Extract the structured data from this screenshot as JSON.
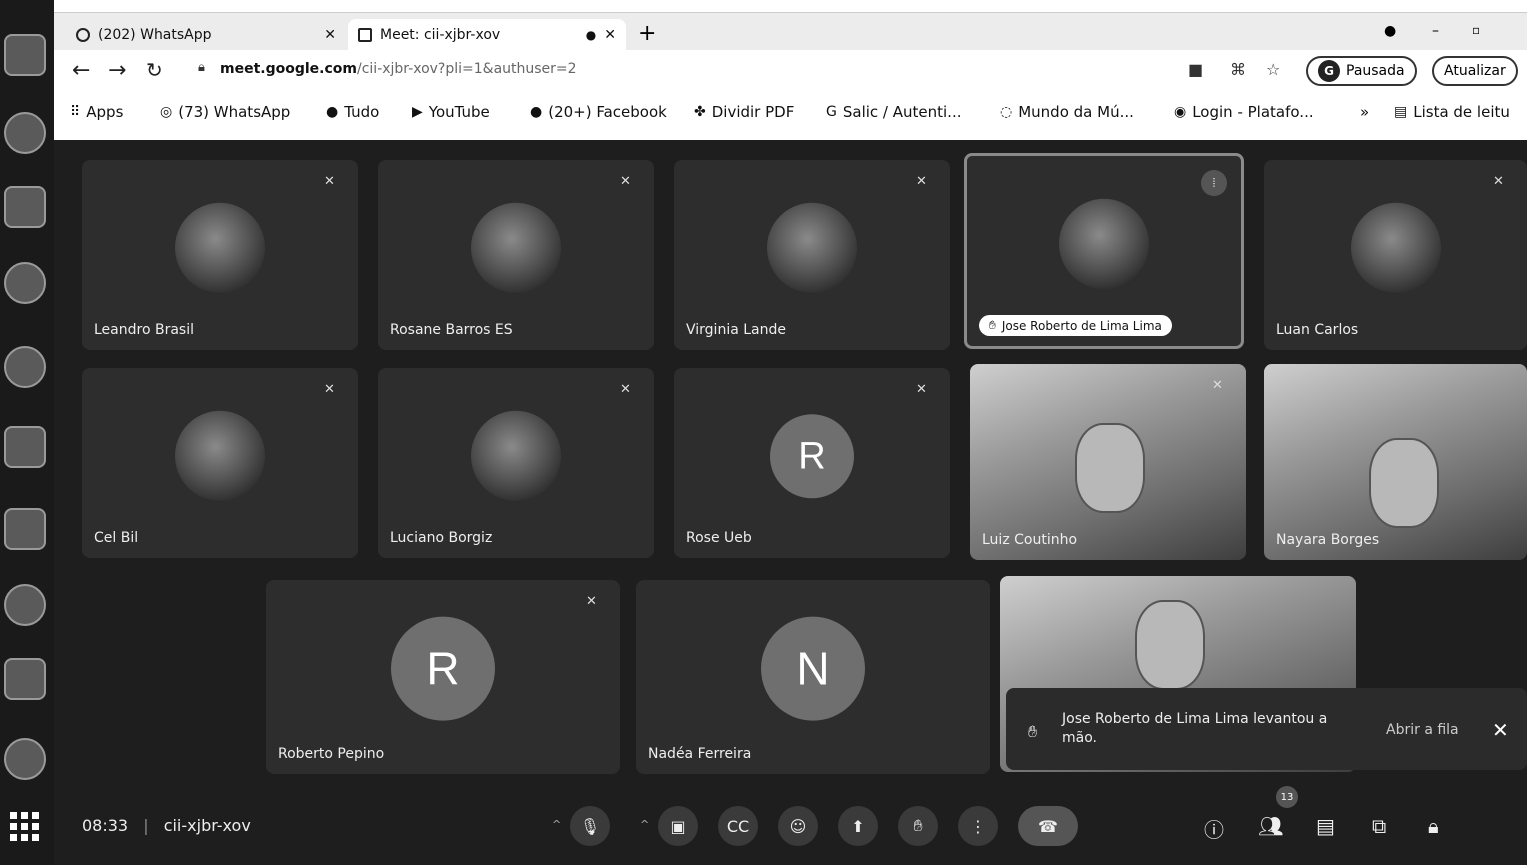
{
  "tabs": [
    {
      "title": "(202) WhatsApp",
      "icon": "whatsapp-icon"
    },
    {
      "title": "Meet: cii-xjbr-xov",
      "icon": "meet-icon"
    }
  ],
  "toolbar": {
    "url_host": "meet.google.com",
    "url_rest": "/cii-xjbr-xov?pli=1&authuser=2",
    "profile_initial": "G",
    "profile_label": "Pausada",
    "update_label": "Atualizar"
  },
  "bookmarks": [
    {
      "label": "Apps",
      "icon": "apps-grid-icon"
    },
    {
      "label": "(73) WhatsApp",
      "icon": "whatsapp-icon"
    },
    {
      "label": "Tudo",
      "icon": "facebook-icon"
    },
    {
      "label": "YouTube",
      "icon": "youtube-icon"
    },
    {
      "label": "(20+) Facebook",
      "icon": "facebook-icon"
    },
    {
      "label": "Dividir PDF",
      "icon": "pdf-icon"
    },
    {
      "label": "Salic / Autenti...",
      "icon": "google-icon"
    },
    {
      "label": "Mundo da Mú...",
      "icon": "music-icon"
    },
    {
      "label": "Login - Platafo...",
      "icon": "globe-icon"
    },
    {
      "label": "»",
      "icon": "more-icon"
    },
    {
      "label": "Lista de leitu",
      "icon": "reading-list-icon"
    }
  ],
  "participants": [
    {
      "name": "Leandro Brasil",
      "avatar": "photo",
      "muted": true
    },
    {
      "name": "Rosane Barros ES",
      "avatar": "photo",
      "muted": true
    },
    {
      "name": "Virginia Lande",
      "avatar": "photo",
      "muted": true
    },
    {
      "name": "Jose Roberto de Lima Lima",
      "avatar": "photo",
      "muted": false,
      "speaking": true
    },
    {
      "name": "Luan Carlos",
      "avatar": "photo",
      "muted": true
    },
    {
      "name": "Cel Bil",
      "avatar": "photo",
      "muted": true
    },
    {
      "name": "Luciano Borgiz",
      "avatar": "photo",
      "muted": true
    },
    {
      "name": "Rose Ueb",
      "avatar": "R",
      "muted": true
    },
    {
      "name": "Luiz Coutinho",
      "avatar": "video",
      "muted": true
    },
    {
      "name": "Nayara Borges",
      "avatar": "video",
      "muted": false
    },
    {
      "name": "Roberto Pepino",
      "avatar": "R",
      "muted": true
    },
    {
      "name": "Nadéa Ferreira",
      "avatar": "N",
      "muted": false
    }
  ],
  "notification": {
    "message": "Jose Roberto de Lima Lima levantou a mão.",
    "action": "Abrir a fila"
  },
  "meeting": {
    "time": "08:33",
    "separator": "|",
    "code": "cii-xjbr-xov",
    "participant_count": "13"
  }
}
